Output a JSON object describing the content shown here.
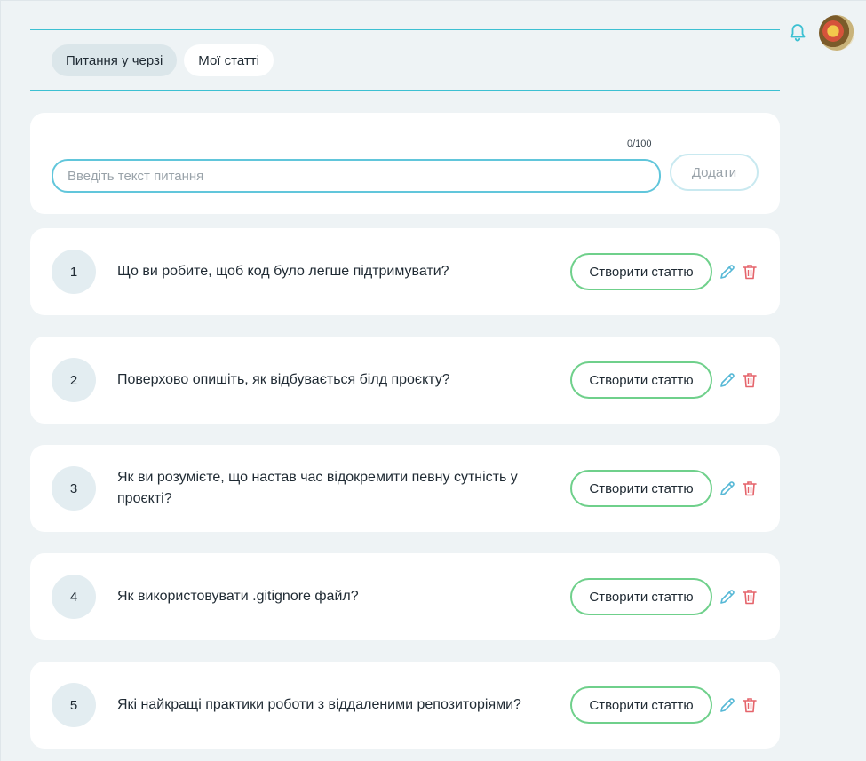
{
  "header": {
    "notification_icon": "bell-icon",
    "avatar_icon": "user-avatar"
  },
  "tabs": [
    {
      "label": "Питання у черзі"
    },
    {
      "label": "Мої статті"
    }
  ],
  "add_form": {
    "counter": "0/100",
    "placeholder": "Введіть текст питання",
    "value": "",
    "add_label": "Додати"
  },
  "questions": [
    {
      "number": "1",
      "text": "Що ви робите, щоб код було легше підтримувати?",
      "create_label": "Створити статтю"
    },
    {
      "number": "2",
      "text": "Поверхово опишіть, як відбувається білд проєкту?",
      "create_label": "Створити статтю"
    },
    {
      "number": "3",
      "text": "Як ви розумієте, що настав час відокремити певну сутність у проєкті?",
      "create_label": "Створити статтю"
    },
    {
      "number": "4",
      "text": "Як використовувати .gitignore файл?",
      "create_label": "Створити статтю"
    },
    {
      "number": "5",
      "text": "Які найкращі практики роботи з віддаленими репозиторіями?",
      "create_label": "Створити статтю"
    }
  ],
  "colors": {
    "accent": "#3cc0d2",
    "create_border": "#6fd08b",
    "edit": "#56b8d6",
    "delete": "#e5646b",
    "background": "#eef3f5"
  }
}
